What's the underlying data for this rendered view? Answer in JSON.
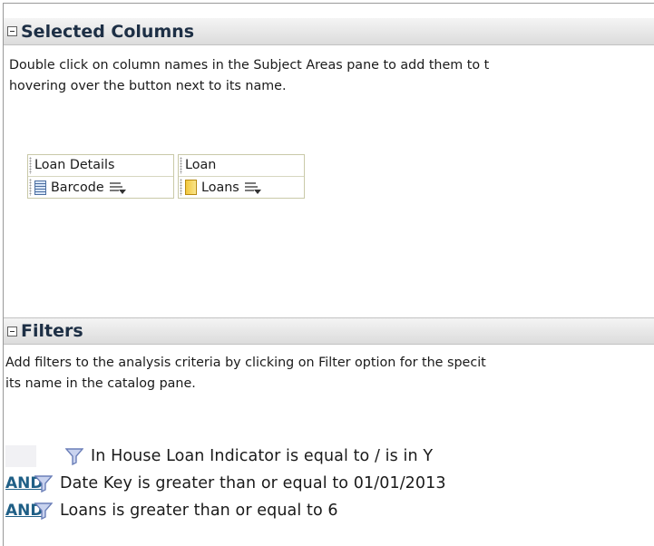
{
  "selected_columns": {
    "title": "Selected Columns",
    "description_line1": "Double click on column names in the Subject Areas pane to add them to t",
    "description_line2": "hovering over the button next to its name.",
    "groups": [
      {
        "header": "Loan Details",
        "column": "Barcode",
        "icon": "barcode-column-icon"
      },
      {
        "header": "Loan",
        "column": "Loans",
        "icon": "measure-column-icon"
      }
    ]
  },
  "filters": {
    "title": "Filters",
    "description_line1": "Add filters to the analysis criteria by clicking on Filter option for the specit",
    "description_line2": "its name in the catalog pane.",
    "items": [
      {
        "connector": "",
        "text": "In House Loan Indicator is equal to / is in  Y"
      },
      {
        "connector": "AND",
        "text": "Date Key  is greater than or equal to  01/01/2013"
      },
      {
        "connector": "AND",
        "text": "Loans  is greater than or equal to  6"
      }
    ]
  },
  "colors": {
    "header_text": "#1d2f45",
    "link": "#1f5f86",
    "funnel": "#6b7fb8"
  }
}
